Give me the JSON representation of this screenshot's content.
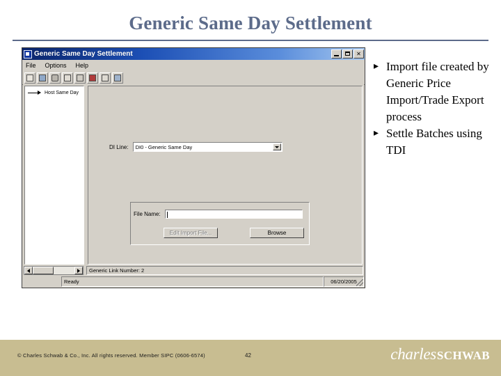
{
  "slide": {
    "title": "Generic Same Day Settlement",
    "page_number": "42"
  },
  "bullets": {
    "marker": "▸",
    "items": [
      "Import file created by Generic Price Import/Trade Export process",
      "Settle Batches using TDI"
    ]
  },
  "app_window": {
    "title": "Generic Same Day Settlement",
    "window_buttons": {
      "minimize": "_",
      "maximize": "□",
      "close": "✕"
    },
    "menu": [
      {
        "label": "File"
      },
      {
        "label": "Options"
      },
      {
        "label": "Help"
      }
    ],
    "toolbar": [
      {
        "name": "help-tool"
      },
      {
        "name": "mail-tool"
      },
      {
        "name": "print-tool"
      },
      {
        "name": "document-tool"
      },
      {
        "name": "clock-tool"
      },
      {
        "name": "settle-tool"
      },
      {
        "name": "edit-tool"
      },
      {
        "name": "export-tool"
      }
    ],
    "tree": {
      "items": [
        {
          "label": "Host Same Day"
        }
      ]
    },
    "form": {
      "di_line_label": "DI Line:",
      "di_line_value": "DI0 - Generic Same Day",
      "file_name_label": "File Name:",
      "file_name_value": "",
      "file_name_placeholder": "",
      "edit_import_button": "Edit Import File...",
      "browse_button": "Browse"
    },
    "status": {
      "link_info": "Generic Link Number:  2",
      "message": "Ready",
      "date": "06/20/2005"
    }
  },
  "footer": {
    "copyright": "© Charles Schwab & Co., Inc.  All rights reserved.  Member SIPC  (0606-6574)",
    "logo_primary": "charles",
    "logo_secondary": "SCHWAB",
    "background_color": "#c8bd91"
  },
  "colors": {
    "title": "#5c6b8a",
    "titlebar_start": "#0a246a",
    "window_face": "#d4d0c8"
  }
}
